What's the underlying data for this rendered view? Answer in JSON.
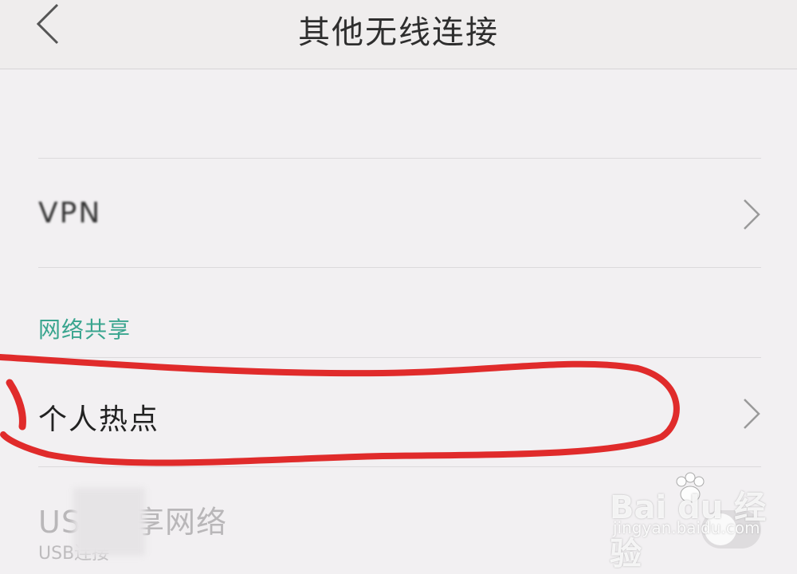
{
  "header": {
    "title": "其他无线连接"
  },
  "rows": {
    "vpn": {
      "label": "VPN"
    },
    "hotspot": {
      "label": "个人热点"
    }
  },
  "section": {
    "tethering_title": "网络共享"
  },
  "usb_row": {
    "label": "USB共享网络",
    "subtitle": "USB连接"
  },
  "watermark": {
    "brand": "Bai du 经验",
    "url": "jingyan.baidu.com"
  },
  "colors": {
    "section_accent": "#3aa58f",
    "annotation": "#e02b2b",
    "background": "#f2f0f2"
  }
}
